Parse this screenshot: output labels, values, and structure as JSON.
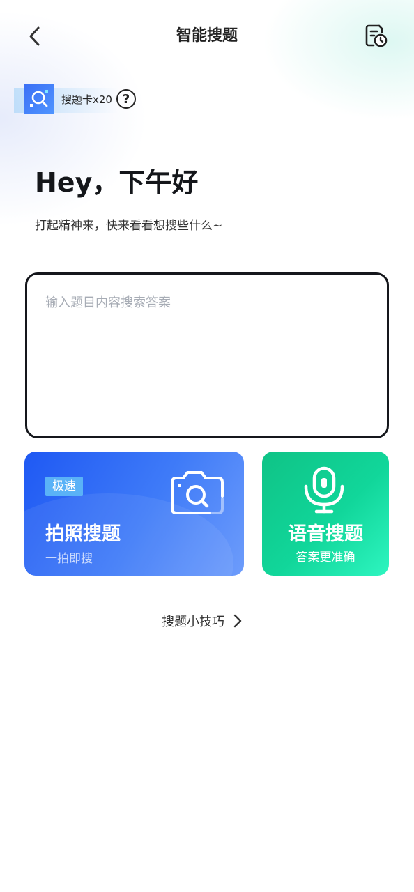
{
  "header": {
    "title": "智能搜题",
    "back_icon": "chevron-left-icon",
    "history_icon": "history-document-icon"
  },
  "search_card": {
    "label": "搜题卡x20",
    "help_symbol": "?"
  },
  "greeting": {
    "title": "Hey，下午好",
    "subtitle": "打起精神来，快来看看想搜些什么~"
  },
  "question_input": {
    "value": "",
    "placeholder": "输入题目内容搜索答案"
  },
  "photo_search": {
    "tag": "极速",
    "title": "拍照搜题",
    "subtitle": "一拍即搜",
    "icon": "camera-search-icon"
  },
  "voice_search": {
    "title": "语音搜题",
    "subtitle": "答案更准确",
    "icon": "microphone-icon"
  },
  "tips": {
    "label": "搜题小技巧"
  },
  "colors": {
    "photo_card": "#2F6BF6",
    "voice_card": "#16D69E",
    "speed_tag": "#5AB2F7",
    "input_border": "#15171C"
  }
}
